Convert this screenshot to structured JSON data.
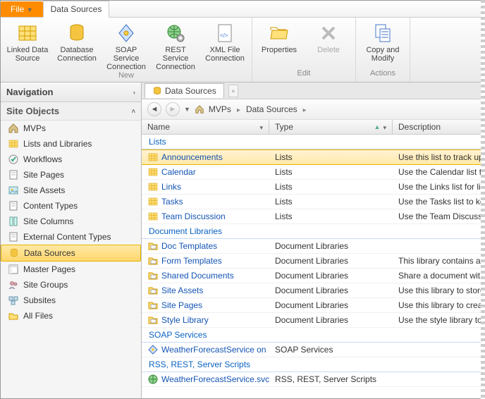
{
  "tabs": {
    "file": "File",
    "active": "Data Sources"
  },
  "ribbon": {
    "groups": [
      {
        "label": "New",
        "items": [
          {
            "id": "linked-data-source",
            "label": "Linked Data\nSource",
            "icon": "table-yellow"
          },
          {
            "id": "database-connection",
            "label": "Database\nConnection",
            "icon": "cylinder"
          },
          {
            "id": "soap-service-connection",
            "label": "SOAP Service\nConnection",
            "icon": "diamond"
          },
          {
            "id": "rest-service-connection",
            "label": "REST Service\nConnection",
            "icon": "globe-gear"
          },
          {
            "id": "xml-file-connection",
            "label": "XML File\nConnection",
            "icon": "xml-doc"
          }
        ]
      },
      {
        "label": "Edit",
        "items": [
          {
            "id": "properties",
            "label": "Properties",
            "icon": "folder-open"
          },
          {
            "id": "delete",
            "label": "Delete",
            "icon": "x-gray",
            "disabled": true
          }
        ]
      },
      {
        "label": "Actions",
        "items": [
          {
            "id": "copy-modify",
            "label": "Copy and\nModify",
            "icon": "copy-list"
          }
        ]
      }
    ]
  },
  "nav": {
    "title": "Navigation",
    "section": "Site Objects",
    "items": [
      {
        "id": "mvps",
        "label": "MVPs",
        "icon": "home"
      },
      {
        "id": "lists",
        "label": "Lists and Libraries",
        "icon": "table-yellow"
      },
      {
        "id": "workflows",
        "label": "Workflows",
        "icon": "check"
      },
      {
        "id": "site-pages",
        "label": "Site Pages",
        "icon": "page"
      },
      {
        "id": "site-assets",
        "label": "Site Assets",
        "icon": "image"
      },
      {
        "id": "content-types",
        "label": "Content Types",
        "icon": "page"
      },
      {
        "id": "site-columns",
        "label": "Site Columns",
        "icon": "column"
      },
      {
        "id": "external-content-types",
        "label": "External Content Types",
        "icon": "page"
      },
      {
        "id": "data-sources",
        "label": "Data Sources",
        "icon": "cylinder",
        "selected": true
      },
      {
        "id": "master-pages",
        "label": "Master Pages",
        "icon": "layout"
      },
      {
        "id": "site-groups",
        "label": "Site Groups",
        "icon": "people"
      },
      {
        "id": "subsites",
        "label": "Subsites",
        "icon": "sites"
      },
      {
        "id": "all-files",
        "label": "All Files",
        "icon": "folder"
      }
    ]
  },
  "content": {
    "tab_label": "Data Sources",
    "breadcrumb": [
      "MVPs",
      "Data Sources"
    ],
    "columns": {
      "name": "Name",
      "type": "Type",
      "desc": "Description"
    },
    "groups": [
      {
        "header": "Lists",
        "rows": [
          {
            "name": "Announcements",
            "type": "Lists",
            "desc": "Use this list to track upco",
            "icon": "table-yellow",
            "selected": true
          },
          {
            "name": "Calendar",
            "type": "Lists",
            "desc": "Use the Calendar list to ke",
            "icon": "table-yellow"
          },
          {
            "name": "Links",
            "type": "Lists",
            "desc": "Use the Links list for links",
            "icon": "table-yellow"
          },
          {
            "name": "Tasks",
            "type": "Lists",
            "desc": "Use the Tasks list to keep",
            "icon": "table-yellow"
          },
          {
            "name": "Team Discussion",
            "type": "Lists",
            "desc": "Use the Team Discussion",
            "icon": "table-yellow"
          }
        ]
      },
      {
        "header": "Document Libraries",
        "rows": [
          {
            "name": "Doc Templates",
            "type": "Document Libraries",
            "desc": "",
            "icon": "doclib"
          },
          {
            "name": "Form Templates",
            "type": "Document Libraries",
            "desc": "This library contains adm",
            "icon": "doclib"
          },
          {
            "name": "Shared Documents",
            "type": "Document Libraries",
            "desc": "Share a document with t",
            "icon": "doclib"
          },
          {
            "name": "Site Assets",
            "type": "Document Libraries",
            "desc": "Use this library to store fi",
            "icon": "doclib"
          },
          {
            "name": "Site Pages",
            "type": "Document Libraries",
            "desc": "Use this library to create a",
            "icon": "doclib"
          },
          {
            "name": "Style Library",
            "type": "Document Libraries",
            "desc": "Use the style library to st",
            "icon": "doclib"
          }
        ]
      },
      {
        "header": "SOAP Services",
        "rows": [
          {
            "name": "WeatherForecastService on ...",
            "type": "SOAP Services",
            "desc": "",
            "icon": "soap"
          }
        ]
      },
      {
        "header": "RSS, REST, Server Scripts",
        "rows": [
          {
            "name": "WeatherForecastService.svc...",
            "type": "RSS, REST, Server Scripts",
            "desc": "",
            "icon": "globe"
          }
        ]
      }
    ]
  }
}
